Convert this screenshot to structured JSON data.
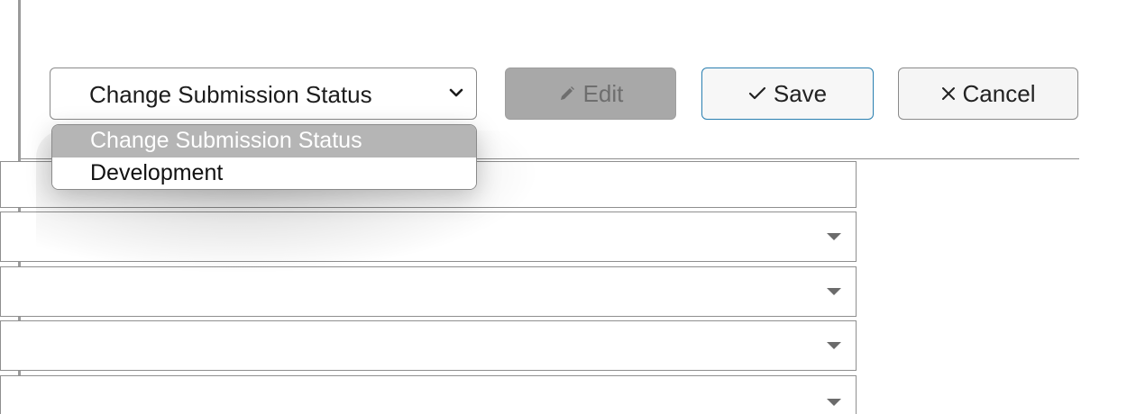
{
  "toolbar": {
    "status_select": {
      "selected": "Change Submission Status",
      "icon": "chevron-down-icon"
    },
    "edit": {
      "label": "Edit",
      "icon": "pencil-icon",
      "disabled": true
    },
    "save": {
      "label": "Save",
      "icon": "check-icon"
    },
    "cancel": {
      "label": "Cancel",
      "icon": "close-icon"
    }
  },
  "dropdown": {
    "options": [
      {
        "label": "Change Submission Status",
        "selected": true
      },
      {
        "label": "Development",
        "selected": false
      }
    ]
  },
  "form": {
    "fields": [
      {
        "type": "text",
        "value": ""
      },
      {
        "type": "select",
        "value": "",
        "icon": "caret-down-icon"
      },
      {
        "type": "select",
        "value": "",
        "icon": "caret-down-icon"
      },
      {
        "type": "select",
        "value": "",
        "icon": "caret-down-icon"
      },
      {
        "type": "select",
        "value": "",
        "icon": "caret-down-icon"
      }
    ]
  },
  "colors": {
    "save_border": "#2a7fb0",
    "edit_disabled_bg": "#a8a8a8",
    "option_highlight": "#b5b5b5"
  }
}
